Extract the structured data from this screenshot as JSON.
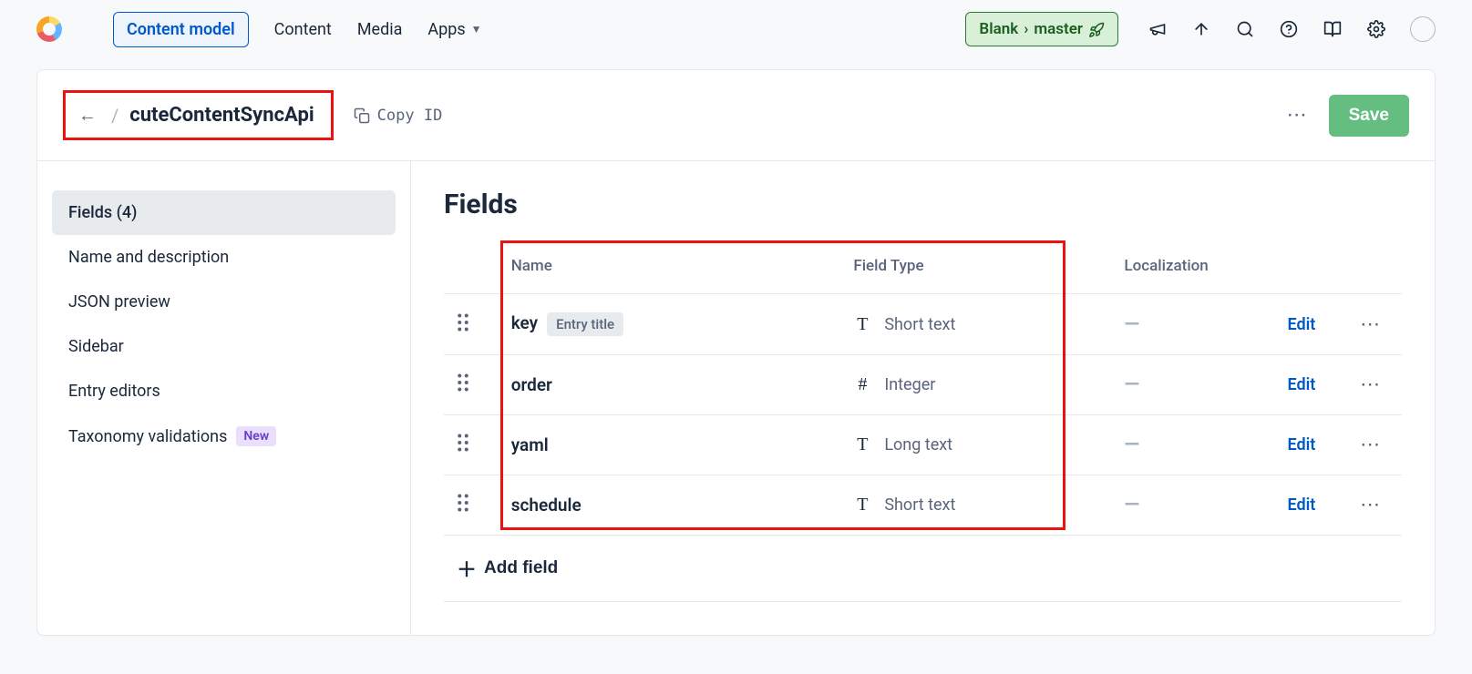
{
  "nav": {
    "tabs": [
      "Content model",
      "Content",
      "Media",
      "Apps"
    ],
    "active_index": 0
  },
  "env": {
    "space": "Blank",
    "branch": "master"
  },
  "header": {
    "title": "cuteContentSyncApi",
    "copy_id_label": "Copy ID",
    "save_label": "Save"
  },
  "sidebar": {
    "items": [
      {
        "label": "Fields (4)",
        "active": true
      },
      {
        "label": "Name and description"
      },
      {
        "label": "JSON preview"
      },
      {
        "label": "Sidebar"
      },
      {
        "label": "Entry editors"
      },
      {
        "label": "Taxonomy validations",
        "badge": "New"
      }
    ]
  },
  "main": {
    "heading": "Fields",
    "columns": [
      "Name",
      "Field Type",
      "Localization"
    ],
    "entry_title_tag": "Entry title",
    "edit_label": "Edit",
    "loc_placeholder": "—",
    "add_field_label": "Add field",
    "fields": [
      {
        "name": "key",
        "type": "Short text",
        "icon": "T",
        "entry_title": true
      },
      {
        "name": "order",
        "type": "Integer",
        "icon": "#"
      },
      {
        "name": "yaml",
        "type": "Long text",
        "icon": "T"
      },
      {
        "name": "schedule",
        "type": "Short text",
        "icon": "T"
      }
    ]
  }
}
